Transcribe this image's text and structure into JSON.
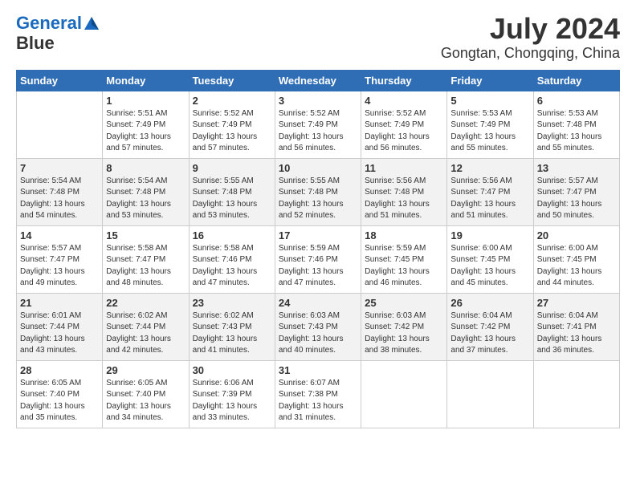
{
  "header": {
    "logo_line1": "General",
    "logo_line2": "Blue",
    "title": "July 2024",
    "subtitle": "Gongtan, Chongqing, China"
  },
  "days_of_week": [
    "Sunday",
    "Monday",
    "Tuesday",
    "Wednesday",
    "Thursday",
    "Friday",
    "Saturday"
  ],
  "weeks": [
    [
      {
        "day": "",
        "sunrise": "",
        "sunset": "",
        "daylight": ""
      },
      {
        "day": "1",
        "sunrise": "5:51 AM",
        "sunset": "7:49 PM",
        "daylight": "13 hours and 57 minutes."
      },
      {
        "day": "2",
        "sunrise": "5:52 AM",
        "sunset": "7:49 PM",
        "daylight": "13 hours and 57 minutes."
      },
      {
        "day": "3",
        "sunrise": "5:52 AM",
        "sunset": "7:49 PM",
        "daylight": "13 hours and 56 minutes."
      },
      {
        "day": "4",
        "sunrise": "5:52 AM",
        "sunset": "7:49 PM",
        "daylight": "13 hours and 56 minutes."
      },
      {
        "day": "5",
        "sunrise": "5:53 AM",
        "sunset": "7:49 PM",
        "daylight": "13 hours and 55 minutes."
      },
      {
        "day": "6",
        "sunrise": "5:53 AM",
        "sunset": "7:48 PM",
        "daylight": "13 hours and 55 minutes."
      }
    ],
    [
      {
        "day": "7",
        "sunrise": "5:54 AM",
        "sunset": "7:48 PM",
        "daylight": "13 hours and 54 minutes."
      },
      {
        "day": "8",
        "sunrise": "5:54 AM",
        "sunset": "7:48 PM",
        "daylight": "13 hours and 53 minutes."
      },
      {
        "day": "9",
        "sunrise": "5:55 AM",
        "sunset": "7:48 PM",
        "daylight": "13 hours and 53 minutes."
      },
      {
        "day": "10",
        "sunrise": "5:55 AM",
        "sunset": "7:48 PM",
        "daylight": "13 hours and 52 minutes."
      },
      {
        "day": "11",
        "sunrise": "5:56 AM",
        "sunset": "7:48 PM",
        "daylight": "13 hours and 51 minutes."
      },
      {
        "day": "12",
        "sunrise": "5:56 AM",
        "sunset": "7:47 PM",
        "daylight": "13 hours and 51 minutes."
      },
      {
        "day": "13",
        "sunrise": "5:57 AM",
        "sunset": "7:47 PM",
        "daylight": "13 hours and 50 minutes."
      }
    ],
    [
      {
        "day": "14",
        "sunrise": "5:57 AM",
        "sunset": "7:47 PM",
        "daylight": "13 hours and 49 minutes."
      },
      {
        "day": "15",
        "sunrise": "5:58 AM",
        "sunset": "7:47 PM",
        "daylight": "13 hours and 48 minutes."
      },
      {
        "day": "16",
        "sunrise": "5:58 AM",
        "sunset": "7:46 PM",
        "daylight": "13 hours and 47 minutes."
      },
      {
        "day": "17",
        "sunrise": "5:59 AM",
        "sunset": "7:46 PM",
        "daylight": "13 hours and 47 minutes."
      },
      {
        "day": "18",
        "sunrise": "5:59 AM",
        "sunset": "7:45 PM",
        "daylight": "13 hours and 46 minutes."
      },
      {
        "day": "19",
        "sunrise": "6:00 AM",
        "sunset": "7:45 PM",
        "daylight": "13 hours and 45 minutes."
      },
      {
        "day": "20",
        "sunrise": "6:00 AM",
        "sunset": "7:45 PM",
        "daylight": "13 hours and 44 minutes."
      }
    ],
    [
      {
        "day": "21",
        "sunrise": "6:01 AM",
        "sunset": "7:44 PM",
        "daylight": "13 hours and 43 minutes."
      },
      {
        "day": "22",
        "sunrise": "6:02 AM",
        "sunset": "7:44 PM",
        "daylight": "13 hours and 42 minutes."
      },
      {
        "day": "23",
        "sunrise": "6:02 AM",
        "sunset": "7:43 PM",
        "daylight": "13 hours and 41 minutes."
      },
      {
        "day": "24",
        "sunrise": "6:03 AM",
        "sunset": "7:43 PM",
        "daylight": "13 hours and 40 minutes."
      },
      {
        "day": "25",
        "sunrise": "6:03 AM",
        "sunset": "7:42 PM",
        "daylight": "13 hours and 38 minutes."
      },
      {
        "day": "26",
        "sunrise": "6:04 AM",
        "sunset": "7:42 PM",
        "daylight": "13 hours and 37 minutes."
      },
      {
        "day": "27",
        "sunrise": "6:04 AM",
        "sunset": "7:41 PM",
        "daylight": "13 hours and 36 minutes."
      }
    ],
    [
      {
        "day": "28",
        "sunrise": "6:05 AM",
        "sunset": "7:40 PM",
        "daylight": "13 hours and 35 minutes."
      },
      {
        "day": "29",
        "sunrise": "6:05 AM",
        "sunset": "7:40 PM",
        "daylight": "13 hours and 34 minutes."
      },
      {
        "day": "30",
        "sunrise": "6:06 AM",
        "sunset": "7:39 PM",
        "daylight": "13 hours and 33 minutes."
      },
      {
        "day": "31",
        "sunrise": "6:07 AM",
        "sunset": "7:38 PM",
        "daylight": "13 hours and 31 minutes."
      },
      {
        "day": "",
        "sunrise": "",
        "sunset": "",
        "daylight": ""
      },
      {
        "day": "",
        "sunrise": "",
        "sunset": "",
        "daylight": ""
      },
      {
        "day": "",
        "sunrise": "",
        "sunset": "",
        "daylight": ""
      }
    ]
  ]
}
